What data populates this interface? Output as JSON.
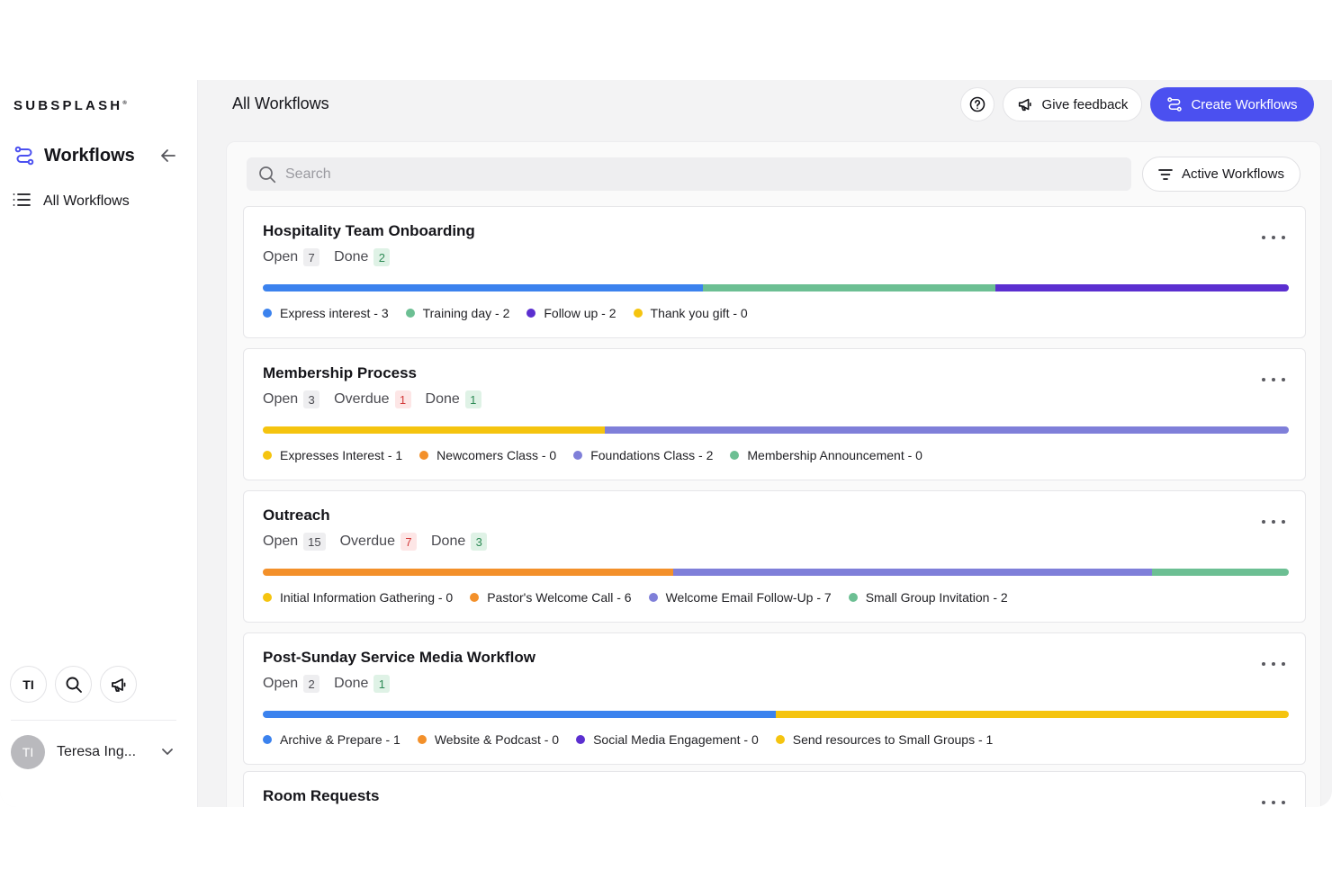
{
  "brand": {
    "name": "SUBSPLASH",
    "mark": "®"
  },
  "sidebar": {
    "title": "Workflows",
    "items": [
      {
        "label": "All Workflows"
      }
    ],
    "tools": {
      "initials": "TI"
    },
    "user": {
      "initials": "TI",
      "name": "Teresa Ing..."
    }
  },
  "header": {
    "title": "All Workflows",
    "feedback_label": "Give feedback",
    "create_label": "Create Workflows"
  },
  "search": {
    "placeholder": "Search",
    "value": ""
  },
  "filter": {
    "label": "Active Workflows"
  },
  "colors": {
    "blue": "#3b82ee",
    "green": "#6cbf93",
    "purple": "#5b2fd0",
    "lavender": "#7f7fd9",
    "yellow": "#f5c40f",
    "orange": "#f3902a",
    "accent": "#4b50f0"
  },
  "workflows": [
    {
      "name": "Hospitality Team Onboarding",
      "stats": [
        {
          "label": "Open",
          "count": "7",
          "tone": "gray"
        },
        {
          "label": "Done",
          "count": "2",
          "tone": "green"
        }
      ],
      "steps": [
        {
          "label": "Express interest - 3",
          "count": 3,
          "color": "#3b82ee"
        },
        {
          "label": "Training day - 2",
          "count": 2,
          "color": "#6cbf93"
        },
        {
          "label": "Follow up - 2",
          "count": 2,
          "color": "#5b2fd0"
        },
        {
          "label": "Thank you gift - 0",
          "count": 0,
          "color": "#f5c40f"
        }
      ]
    },
    {
      "name": "Membership Process",
      "stats": [
        {
          "label": "Open",
          "count": "3",
          "tone": "gray"
        },
        {
          "label": "Overdue",
          "count": "1",
          "tone": "red"
        },
        {
          "label": "Done",
          "count": "1",
          "tone": "green"
        }
      ],
      "steps": [
        {
          "label": "Expresses Interest - 1",
          "count": 1,
          "color": "#f5c40f"
        },
        {
          "label": "Newcomers Class - 0",
          "count": 0,
          "color": "#f3902a"
        },
        {
          "label": "Foundations Class - 2",
          "count": 2,
          "color": "#7f7fd9"
        },
        {
          "label": "Membership Announcement - 0",
          "count": 0,
          "color": "#6cbf93"
        }
      ]
    },
    {
      "name": "Outreach",
      "stats": [
        {
          "label": "Open",
          "count": "15",
          "tone": "gray"
        },
        {
          "label": "Overdue",
          "count": "7",
          "tone": "red"
        },
        {
          "label": "Done",
          "count": "3",
          "tone": "green"
        }
      ],
      "steps": [
        {
          "label": "Initial Information Gathering - 0",
          "count": 0,
          "color": "#f5c40f"
        },
        {
          "label": "Pastor's Welcome Call - 6",
          "count": 6,
          "color": "#f3902a"
        },
        {
          "label": "Welcome Email Follow-Up - 7",
          "count": 7,
          "color": "#7f7fd9"
        },
        {
          "label": "Small Group Invitation - 2",
          "count": 2,
          "color": "#6cbf93"
        }
      ]
    },
    {
      "name": "Post-Sunday Service Media Workflow",
      "stats": [
        {
          "label": "Open",
          "count": "2",
          "tone": "gray"
        },
        {
          "label": "Done",
          "count": "1",
          "tone": "green"
        }
      ],
      "steps": [
        {
          "label": "Archive & Prepare - 1",
          "count": 1,
          "color": "#3b82ee"
        },
        {
          "label": "Website & Podcast - 0",
          "count": 0,
          "color": "#f3902a"
        },
        {
          "label": "Social Media Engagement - 0",
          "count": 0,
          "color": "#5b2fd0"
        },
        {
          "label": "Send resources to Small Groups - 1",
          "count": 1,
          "color": "#f5c40f"
        }
      ]
    },
    {
      "name": "Room Requests",
      "stats": [],
      "steps": []
    }
  ]
}
